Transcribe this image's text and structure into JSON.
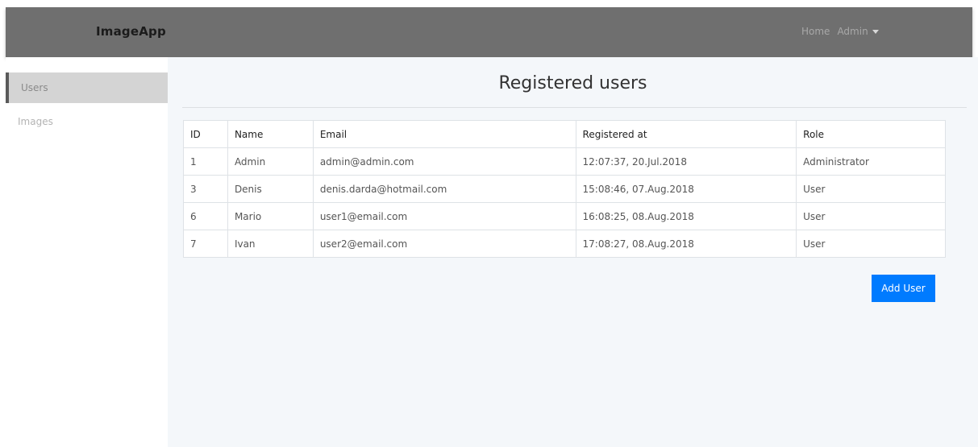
{
  "navbar": {
    "brand": "ImageApp",
    "home_label": "Home",
    "admin_label": "Admin"
  },
  "sidebar": {
    "items": [
      {
        "label": "Users",
        "active": true
      },
      {
        "label": "Images",
        "active": false
      }
    ]
  },
  "main": {
    "title": "Registered users",
    "table": {
      "headers": [
        "ID",
        "Name",
        "Email",
        "Registered at",
        "Role"
      ],
      "rows": [
        [
          "1",
          "Admin",
          "admin@admin.com",
          "12:07:37, 20.Jul.2018",
          "Administrator"
        ],
        [
          "3",
          "Denis",
          "denis.darda@hotmail.com",
          "15:08:46, 07.Aug.2018",
          "User"
        ],
        [
          "6",
          "Mario",
          "user1@email.com",
          "16:08:25, 08.Aug.2018",
          "User"
        ],
        [
          "7",
          "Ivan",
          "user2@email.com",
          "17:08:27, 08.Aug.2018",
          "User"
        ]
      ]
    },
    "add_button_label": "Add User"
  },
  "colors": {
    "navbar_bg": "#6f6f6f",
    "content_bg": "#f4f7fa",
    "button_primary": "#007bff"
  }
}
